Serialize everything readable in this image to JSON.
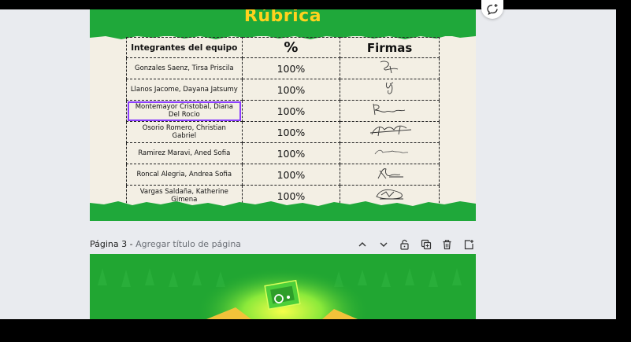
{
  "page2": {
    "title": "Rúbrica",
    "table": {
      "headers": [
        "Integrantes del equipo",
        "%",
        "Firmas"
      ],
      "rows": [
        {
          "name": "Gonzales Saenz, Tirsa Priscila",
          "percent": "100%"
        },
        {
          "name": "Llanos Jacome, Dayana Jatsumy",
          "percent": "100%"
        },
        {
          "name": "Montemayor Cristobal, Diana Del Rocio",
          "percent": "100%"
        },
        {
          "name": "Osorio Romero, Christian Gabriel",
          "percent": "100%"
        },
        {
          "name": "Ramirez Maravi, Aned Sofia",
          "percent": "100%"
        },
        {
          "name": "Roncal Alegria, Andrea Sofia",
          "percent": "100%"
        },
        {
          "name": "Vargas Saldaña, Katherine Gimena",
          "percent": "100%"
        }
      ]
    }
  },
  "page_bar": {
    "page_label": "Página 3 -",
    "title_placeholder": "Agregar título de página"
  },
  "colors": {
    "green": "#1fa83a",
    "title_yellow": "#ffd21e",
    "selection": "#8b3dff"
  },
  "icons": [
    "add-comment-icon",
    "chevron-up-icon",
    "chevron-down-icon",
    "lock-icon",
    "duplicate-icon",
    "trash-icon",
    "add-page-icon"
  ]
}
